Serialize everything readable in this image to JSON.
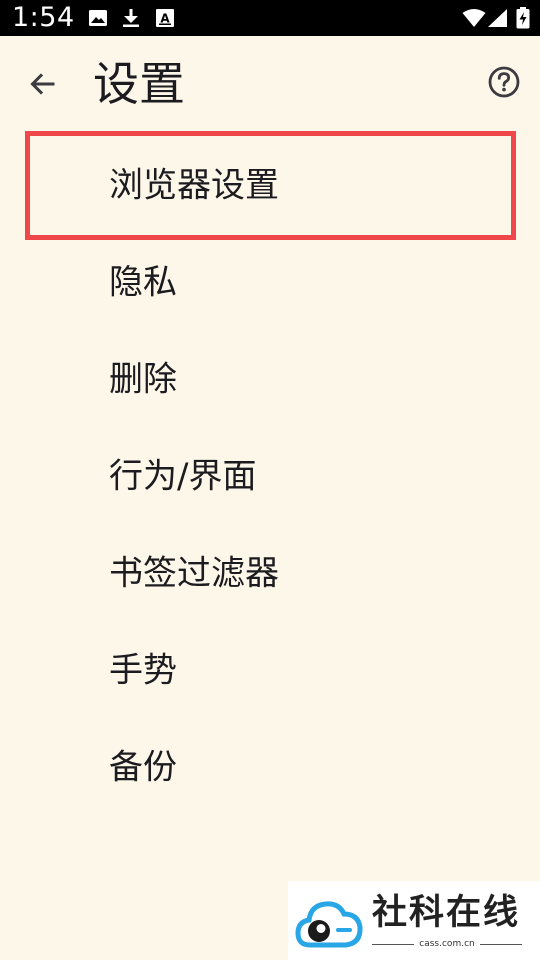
{
  "status_bar": {
    "time": "1:54",
    "icons": [
      "image-icon",
      "download-icon",
      "text-a-icon",
      "wifi-icon",
      "signal-icon",
      "battery-charging-icon"
    ]
  },
  "app_bar": {
    "title": "设置",
    "back_icon": "arrow-left-icon",
    "help_icon": "help-circle-icon"
  },
  "settings": {
    "items": [
      {
        "label": "浏览器设置",
        "highlighted": true
      },
      {
        "label": "隐私"
      },
      {
        "label": "删除"
      },
      {
        "label": "行为/界面"
      },
      {
        "label": "书签过滤器"
      },
      {
        "label": "手势"
      },
      {
        "label": "备份"
      }
    ]
  },
  "highlight": {
    "color": "#f0474b"
  },
  "watermark": {
    "name": "社科在线",
    "url": "cass.com.cn",
    "accent": "#29a6e6"
  },
  "colors": {
    "background": "#fdf7ea",
    "status_bar": "#000000",
    "text": "#1c1b1f"
  }
}
